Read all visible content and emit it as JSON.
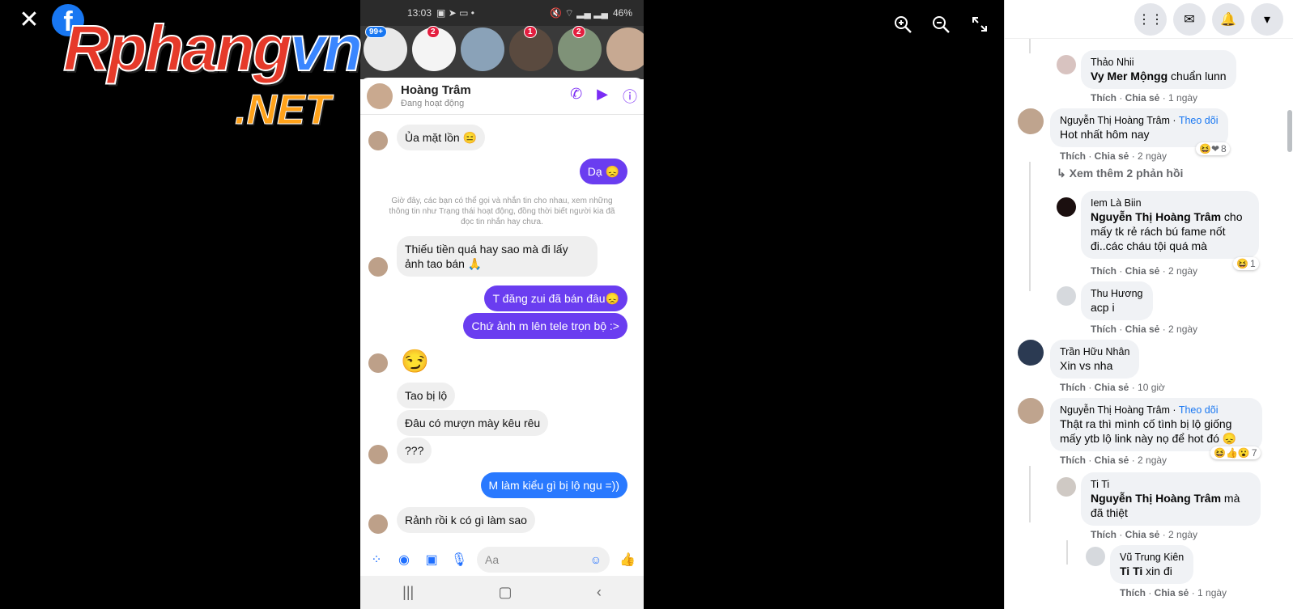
{
  "viewer": {
    "close": "✕",
    "fb_logo": "f",
    "watermark_main_a": "Rphang",
    "watermark_main_b": "vn",
    "watermark_net": ".NET"
  },
  "phone": {
    "time": "13:03",
    "battery": "46%",
    "stories_badges": [
      "99+",
      "2",
      "",
      "1",
      "2",
      ""
    ],
    "chat_name": "Hoàng Trâm",
    "chat_status": "Đang hoạt động",
    "system_note": "Giờ đây, các bạn có thể gọi và nhắn tin cho nhau, xem những thông tin như Trạng thái hoạt động, đồng thời biết người kia đã đọc tin nhắn hay chưa.",
    "messages": [
      "Ủa mặt lồn 😑",
      "Dạ 😞",
      "Thiếu tiền quá hay sao mà đi lấy ảnh tao bán 🙏",
      "T đăng zui đã bán đâu😞",
      "Chứ ảnh m lên tele trọn bộ :>",
      "😏",
      "Tao bị lộ",
      "Đâu có mượn mày kêu rêu",
      "???",
      "M làm kiểu gì bị lộ ngu =))",
      "Rảnh rồi k có gì làm sao"
    ],
    "input_placeholder": "Aa"
  },
  "comments": [
    {
      "author": "Thảo Nhii",
      "tag": "Vy Mer Mộngg",
      "text": " chuẩn lunn",
      "meta": "1 ngày"
    },
    {
      "author": "Nguyễn Thị Hoàng Trâm",
      "follow": "Theo dõi",
      "text": "Hot nhất hôm nay",
      "meta": "2 ngày",
      "reactions": "8"
    },
    {
      "more": "Xem thêm 2 phản hồi"
    },
    {
      "author": "Iem Là Biin",
      "tag": "Nguyễn Thị Hoàng Trâm",
      "text": " cho mấy tk rẻ rách bú fame nốt đi..các cháu tội quá mà",
      "meta": "2 ngày",
      "reactions": "1"
    },
    {
      "author": "Thu Hương",
      "text": "acp i",
      "meta": "2 ngày"
    },
    {
      "author": "Trần Hữu Nhân",
      "text": "Xin vs nha",
      "meta": "10 giờ"
    },
    {
      "author": "Nguyễn Thị Hoàng Trâm",
      "follow": "Theo dõi",
      "text": "Thật ra thì mình cố tình bị lộ giống mấy ytb lộ link này nọ để hot đó 😞",
      "meta": "2 ngày",
      "reactions": "7"
    },
    {
      "author": "Ti Ti",
      "tag": "Nguyễn Thị Hoàng Trâm",
      "text": " mà đã thiệt",
      "meta": "2 ngày"
    },
    {
      "author": "Vũ Trung Kiên",
      "tag": "Ti Ti",
      "text": " xin đi",
      "meta": "1 ngày"
    }
  ],
  "labels": {
    "like": "Thích",
    "share": "Chia sẻ",
    "sep": " · "
  }
}
